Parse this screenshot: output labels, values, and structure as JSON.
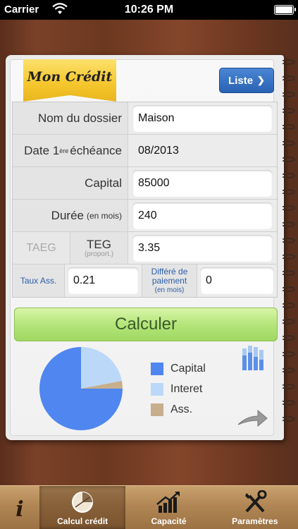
{
  "status_bar": {
    "carrier": "Carrier",
    "time": "10:26 PM"
  },
  "header": {
    "title": "Mon Crédit",
    "list_button": "Liste"
  },
  "form": {
    "folder_name": {
      "label": "Nom du dossier",
      "value": "Maison"
    },
    "first_due": {
      "label": "Date 1ère échéance",
      "label_main": "Date 1",
      "label_sup": "ère",
      "label_tail": " échéance",
      "value": "08/2013"
    },
    "capital": {
      "label": "Capital",
      "value": "85000"
    },
    "duration": {
      "label": "Durée",
      "unit": "(en mois)",
      "value": "240"
    },
    "rate": {
      "taeg_label": "TAEG",
      "teg_label": "TEG",
      "teg_sub": "(proport.)",
      "value": "3.35"
    },
    "insurance": {
      "label": "Taux Ass.",
      "value": "0.21"
    },
    "deferral": {
      "label": "Différé de paiement",
      "label_line1": "Différé de",
      "label_line2": "paiement",
      "unit": "(en mois)",
      "value": "0"
    }
  },
  "calculate_button": "Calculer",
  "legend": [
    {
      "label": "Capital",
      "color": "#4f86f0"
    },
    {
      "label": "Interet",
      "color": "#bcd8f8"
    },
    {
      "label": "Ass.",
      "color": "#c7ae8c"
    }
  ],
  "chart_data": {
    "type": "pie",
    "categories": [
      "Capital",
      "Interet",
      "Ass."
    ],
    "values": [
      75,
      22,
      3
    ]
  },
  "tabs": [
    {
      "label": "",
      "icon": "info-icon"
    },
    {
      "label": "Calcul crédit",
      "icon": "calculator-pie-icon",
      "active": true
    },
    {
      "label": "Capacité",
      "icon": "growth-chart-icon"
    },
    {
      "label": "Paramètres",
      "icon": "tools-icon"
    }
  ]
}
